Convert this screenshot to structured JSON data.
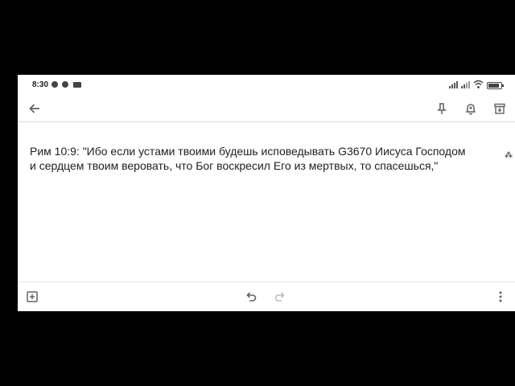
{
  "status_bar": {
    "time": "8:30",
    "notifications": [
      "facebook-icon",
      "facebook-icon",
      "video-camera-icon"
    ],
    "system_icons": [
      "signal-icon",
      "signal-icon",
      "wifi-icon",
      "battery-icon"
    ],
    "battery_level": 0.85
  },
  "toolbar": {
    "back_icon": "arrow-left-icon",
    "actions": [
      "pin-icon",
      "reminder-bell-icon",
      "archive-icon"
    ]
  },
  "note": {
    "line1": "Рим 10:9: \"Ибо если устами твоими будешь исповедывать G3670 Иисуса Господом",
    "line2": "и сердцем твоим веровать, что Бог воскресил Его из мертвых, то спасешься,\"",
    "edge_mark": "⁂"
  },
  "bottom_bar": {
    "left_icon": "add-box-icon",
    "center_icons": [
      "undo-icon",
      "redo-icon"
    ],
    "right_icon": "more-vert-icon"
  },
  "colors": {
    "background": "#000000",
    "screen": "#ffffff",
    "icon": "#5f6368",
    "text": "#202124",
    "disabled": "#bdbdbd"
  }
}
